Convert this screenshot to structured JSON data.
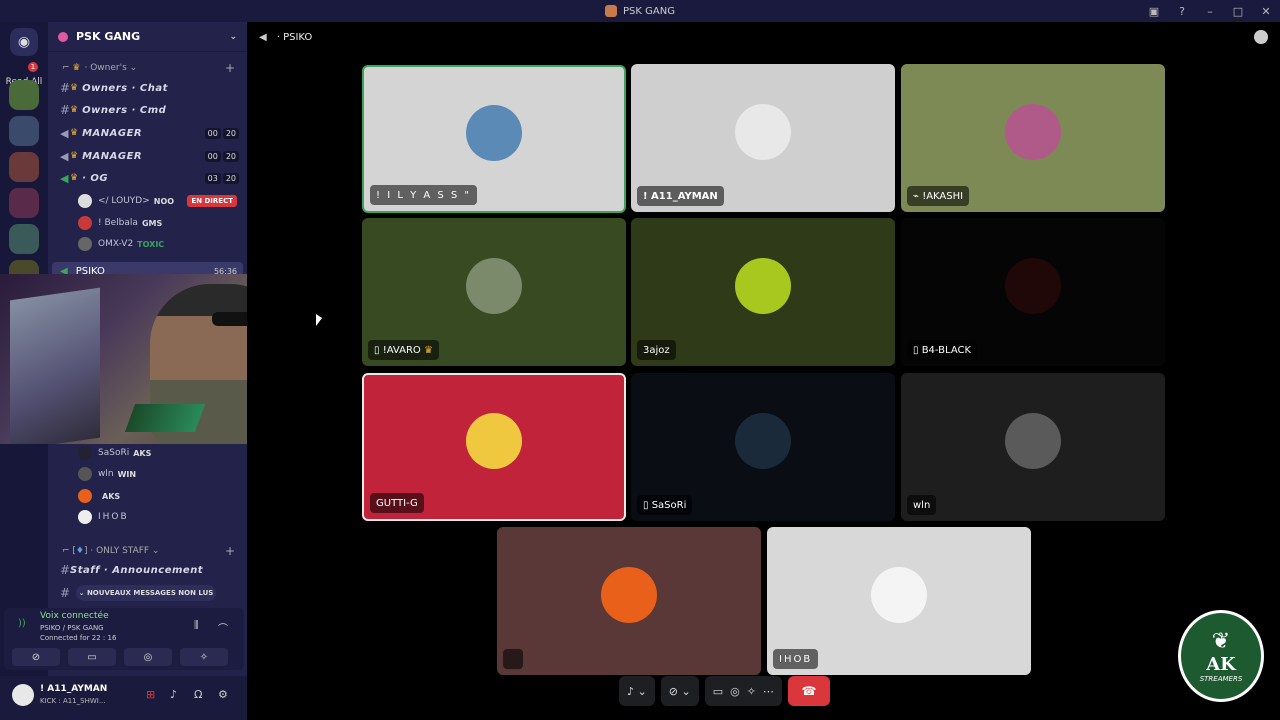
{
  "window": {
    "title": "PSK GANG"
  },
  "rail": {
    "badge": "1",
    "read_all": "Read All"
  },
  "server": {
    "name": "PSK GANG"
  },
  "channels": {
    "owner_category": "Owner's",
    "owners_chat": "Owners · Chat",
    "owners_cmd": "Owners · Cmd",
    "manager1": {
      "name": "MANAGER",
      "count_a": "00",
      "count_b": "20"
    },
    "manager2": {
      "name": "MANAGER",
      "count_a": "00",
      "count_b": "20"
    },
    "og": {
      "name": "· OG",
      "count_a": "03",
      "count_b": "20"
    },
    "og_users": [
      {
        "name": "</ LOUYD>",
        "tag": "NOO",
        "live": "EN DIRECT"
      },
      {
        "name": "! Belbala",
        "tag": "GMS"
      },
      {
        "name": "OMX-V2",
        "tag": "TOXIC"
      }
    ],
    "active": {
      "name": "PSIKO",
      "time": "56:36"
    },
    "psiko_users": [
      {
        "name": "SaSoRi",
        "tag": "AKS"
      },
      {
        "name": "wln",
        "tag": "WIN"
      },
      {
        "name": "",
        "tag": "AKS"
      },
      {
        "name": "IHOB",
        "tag": ""
      }
    ],
    "staff_category": "ONLY STAFF",
    "staff_announcement": "Staff · Announcement",
    "unread_pill": "NOUVEAUX MESSAGES NON LUS"
  },
  "voice_panel": {
    "status": "Voix connectée",
    "location": "PSIKO / PSK GANG",
    "duration": "Connected for 22 : 16"
  },
  "user_panel": {
    "name": "! A11_AYMAN",
    "status": "KICK : A11_SHWI..."
  },
  "main": {
    "channel": "PSIKO",
    "tiles": [
      {
        "label": "! I L Y A S S \"",
        "bg": "#d4d4d4",
        "avatar": "#5a8ab5"
      },
      {
        "label": "! A11_AYMAN",
        "bg": "#cfcfcf",
        "avatar": "#e8e8e8"
      },
      {
        "label": "!AKASHI",
        "bg": "#7d8a55",
        "avatar": "#b05a8a"
      },
      {
        "label": "!AVARO",
        "bg": "#374a22",
        "avatar": "#7a8a6a"
      },
      {
        "label": "3ajoz",
        "bg": "#2f3a18",
        "avatar": "#a8c820"
      },
      {
        "label": "B4-BLACK",
        "bg": "#050505",
        "avatar": "#200808"
      },
      {
        "label": "GUTTI-G",
        "bg": "#c0233a",
        "avatar": "#f0c840"
      },
      {
        "label": "SaSoRi",
        "bg": "#0a0d14",
        "avatar": "#1a2a3a"
      },
      {
        "label": "wln",
        "bg": "#1e1e1e",
        "avatar": "#5a5a5a"
      },
      {
        "label": "",
        "bg": "#5a3838",
        "avatar": "#e8601a"
      },
      {
        "label": "IHOB",
        "bg": "#d8d8d8",
        "avatar": "#f4f4f4"
      }
    ]
  },
  "logo": {
    "text": "AK",
    "sub": "STREAMERS"
  }
}
